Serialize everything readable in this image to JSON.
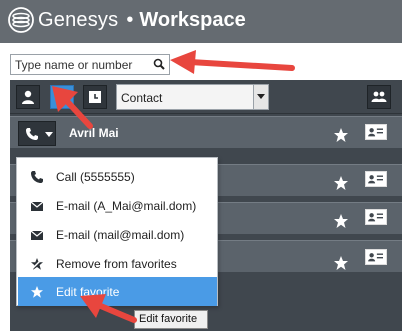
{
  "titlebar": {
    "logo_text": "Genesys",
    "separator": "•",
    "product": "Workspace"
  },
  "search": {
    "placeholder": "Type name or number",
    "icon": "search-icon"
  },
  "toolbar": {
    "buttons": [
      {
        "icon": "person-icon",
        "active": false
      },
      {
        "icon": "star-icon",
        "active": true
      },
      {
        "icon": "recent-icon",
        "active": false
      }
    ],
    "filter_value": "Contact",
    "group_icon": "group-icon"
  },
  "contacts": [
    {
      "name": "Avril Mai",
      "favorite": true
    },
    {
      "name": "",
      "favorite": true
    },
    {
      "name": "",
      "favorite": true
    },
    {
      "name": "",
      "favorite": true
    }
  ],
  "menu": {
    "items": [
      {
        "label": "Call (5555555)",
        "icon": "phone-icon"
      },
      {
        "label": "E-mail (A_Mai@mail.dom)",
        "icon": "envelope-icon"
      },
      {
        "label": "E-mail (mail@mail.dom)",
        "icon": "envelope-icon"
      },
      {
        "label": "Remove from favorites",
        "icon": "remove-favorite-icon"
      },
      {
        "label": "Edit favorite",
        "icon": "edit-favorite-icon",
        "selected": true
      }
    ]
  },
  "tooltip": "Edit favorite",
  "colors": {
    "titlebar": "#656b71",
    "panel": "#40474e",
    "row": "#5b636b",
    "accent": "#3a8fd8",
    "menu_selected": "#4a9be6",
    "annotation_arrow": "#e8463e"
  }
}
